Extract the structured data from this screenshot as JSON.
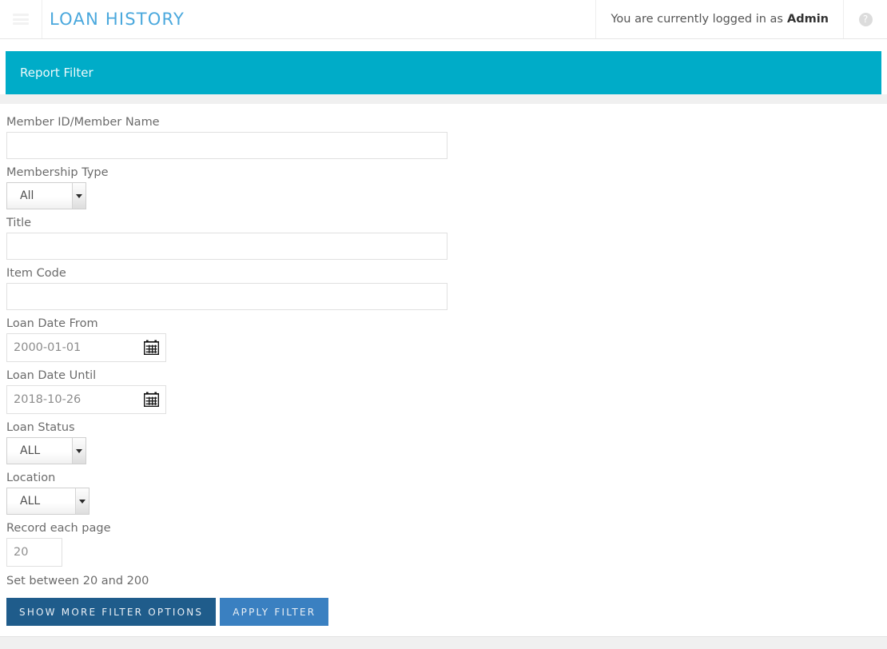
{
  "header": {
    "menu_icon": "hamburger-icon",
    "title": "LOAN HISTORY",
    "login_prefix": "You are currently logged in as",
    "login_user": "Admin",
    "help_icon": "?",
    "brand_color": "#4aa8dd"
  },
  "panel": {
    "title": "Report Filter",
    "accent_color": "#00acc8"
  },
  "form": {
    "member": {
      "label": "Member ID/Member Name",
      "value": "",
      "placeholder": ""
    },
    "membership_type": {
      "label": "Membership Type",
      "value": "All",
      "options": [
        "All"
      ]
    },
    "title_field": {
      "label": "Title",
      "value": "",
      "placeholder": ""
    },
    "item_code": {
      "label": "Item Code",
      "value": "",
      "placeholder": ""
    },
    "loan_date_from": {
      "label": "Loan Date From",
      "value": "2000-01-01",
      "placeholder": "2000-01-01",
      "icon": "calendar-icon"
    },
    "loan_date_until": {
      "label": "Loan Date Until",
      "value": "2018-10-26",
      "placeholder": "2018-10-26",
      "icon": "calendar-icon"
    },
    "loan_status": {
      "label": "Loan Status",
      "value": "ALL",
      "options": [
        "ALL"
      ]
    },
    "location": {
      "label": "Location",
      "value": "ALL",
      "options": [
        "ALL"
      ]
    },
    "record_each_page": {
      "label": "Record each page",
      "value": "20",
      "placeholder": "20",
      "hint": "Set between 20 and 200"
    }
  },
  "buttons": {
    "show_more": {
      "label": "SHOW MORE FILTER OPTIONS",
      "color": "#1f5c8b"
    },
    "apply_filter": {
      "label": "APPLY FILTER",
      "color": "#3a80c1"
    }
  }
}
